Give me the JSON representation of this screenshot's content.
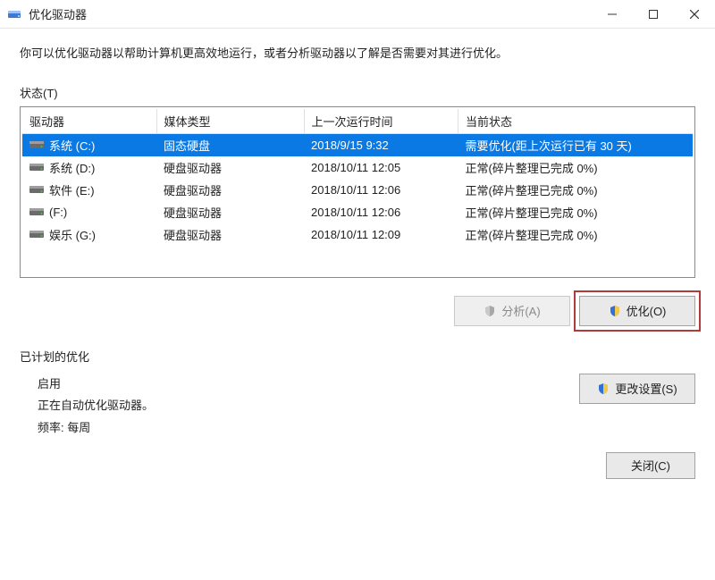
{
  "titlebar": {
    "title": "优化驱动器"
  },
  "intro": "你可以优化驱动器以帮助计算机更高效地运行，或者分析驱动器以了解是否需要对其进行优化。",
  "status_label": "状态(T)",
  "columns": {
    "drive": "驱动器",
    "media": "媒体类型",
    "last_run": "上一次运行时间",
    "current": "当前状态"
  },
  "drives": [
    {
      "name": "系统 (C:)",
      "media": "固态硬盘",
      "last_run": "2018/9/15 9:32",
      "status": "需要优化(距上次运行已有 30 天)",
      "selected": true
    },
    {
      "name": "系统 (D:)",
      "media": "硬盘驱动器",
      "last_run": "2018/10/11 12:05",
      "status": "正常(碎片整理已完成 0%)",
      "selected": false
    },
    {
      "name": "软件 (E:)",
      "media": "硬盘驱动器",
      "last_run": "2018/10/11 12:06",
      "status": "正常(碎片整理已完成 0%)",
      "selected": false
    },
    {
      "name": "(F:)",
      "media": "硬盘驱动器",
      "last_run": "2018/10/11 12:06",
      "status": "正常(碎片整理已完成 0%)",
      "selected": false
    },
    {
      "name": "娱乐 (G:)",
      "media": "硬盘驱动器",
      "last_run": "2018/10/11 12:09",
      "status": "正常(碎片整理已完成 0%)",
      "selected": false
    }
  ],
  "buttons": {
    "analyze": "分析(A)",
    "optimize": "优化(O)",
    "change_settings": "更改设置(S)",
    "close": "关闭(C)"
  },
  "scheduled": {
    "section_label": "已计划的优化",
    "enabled_label": "启用",
    "status_line": "正在自动优化驱动器。",
    "frequency_line": "频率: 每周"
  }
}
